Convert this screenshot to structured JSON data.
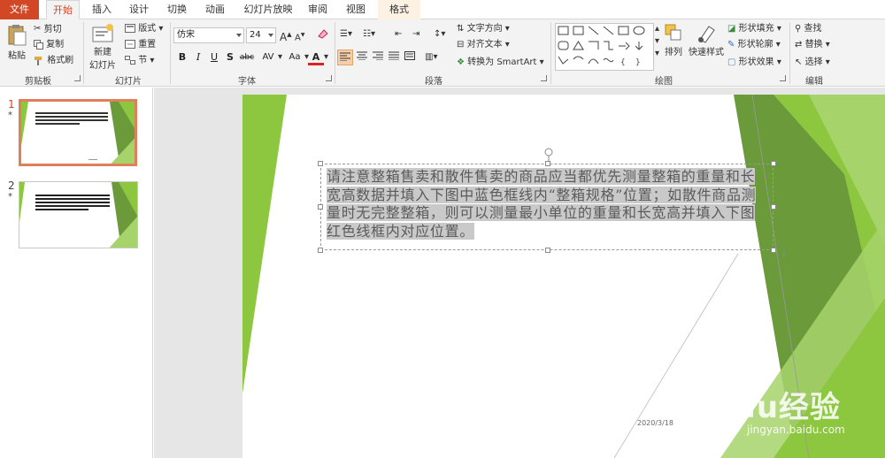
{
  "tabs": [
    {
      "label": "文件"
    },
    {
      "label": "开始"
    },
    {
      "label": "插入"
    },
    {
      "label": "设计"
    },
    {
      "label": "切换"
    },
    {
      "label": "动画"
    },
    {
      "label": "幻灯片放映"
    },
    {
      "label": "审阅"
    },
    {
      "label": "视图"
    },
    {
      "label": "格式"
    }
  ],
  "ribbon": {
    "clipboard": {
      "paste": "粘贴",
      "cut": "剪切",
      "copy": "复制",
      "format_painter": "格式刷",
      "group": "剪贴板"
    },
    "slides": {
      "new_slide_line1": "新建",
      "new_slide_line2": "幻灯片",
      "layout": "版式",
      "reset": "重置",
      "section": "节",
      "group": "幻灯片"
    },
    "font": {
      "name": "仿宋",
      "size": "24",
      "group": "字体",
      "bold": "B",
      "italic": "I",
      "underline": "U",
      "shadow": "S",
      "strike": "abc",
      "spacing": "AV",
      "case": "Aa",
      "color": "A"
    },
    "paragraph": {
      "text_direction": "文字方向",
      "align_text": "对齐文本",
      "smartart": "转换为 SmartArt",
      "group": "段落"
    },
    "drawing": {
      "arrange": "排列",
      "quick_styles": "快速样式",
      "shape_fill": "形状填充",
      "shape_outline": "形状轮廓",
      "shape_effects": "形状效果",
      "group": "绘图"
    },
    "editing": {
      "find": "查找",
      "replace": "替换",
      "select": "选择",
      "group": "编辑"
    }
  },
  "colors": {
    "accent": "#d24726",
    "green_light": "#8dc63f",
    "green_dark": "#6a9a3a",
    "highlight": "#c9c9c9"
  },
  "thumbnails": [
    {
      "number": "1",
      "mark": "*"
    },
    {
      "number": "2",
      "mark": "*"
    }
  ],
  "slide": {
    "body_text": "请注意整箱售卖和散件售卖的商品应当都优先测量整箱的重量和长宽高数据并填入下图中蓝色框线内“整箱规格”位置；如散件商品测量时无完整整箱，则可以测量最小单位的重量和长宽高并填入下图红色线框内对应位置。",
    "date": "2020/3/18"
  },
  "watermark": {
    "brand": "Baidu经验",
    "url": "jingyan.baidu.com"
  }
}
